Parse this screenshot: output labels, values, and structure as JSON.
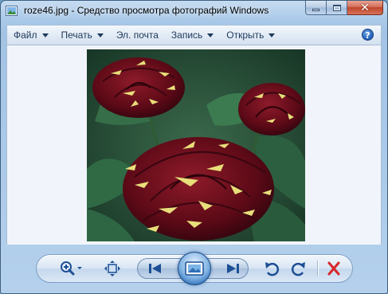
{
  "window": {
    "title": "roze46.jpg - Средство просмотра фотографий Windows"
  },
  "menu": {
    "items": [
      {
        "label": "Файл",
        "has_arrow": true
      },
      {
        "label": "Печать",
        "has_arrow": true
      },
      {
        "label": "Эл. почта",
        "has_arrow": false
      },
      {
        "label": "Запись",
        "has_arrow": true
      },
      {
        "label": "Открыть",
        "has_arrow": true
      }
    ],
    "help_label": "?"
  },
  "toolbar": {
    "buttons": [
      "zoom-icon",
      "fit-to-window-icon",
      "previous-icon",
      "slideshow-icon",
      "next-icon",
      "rotate-counterclockwise-icon",
      "rotate-clockwise-icon",
      "delete-icon"
    ]
  },
  "colors": {
    "accent": "#1f5fb8",
    "delete": "#d8262a",
    "rose": "#6e0d1a",
    "stripe": "#e8de7a"
  }
}
